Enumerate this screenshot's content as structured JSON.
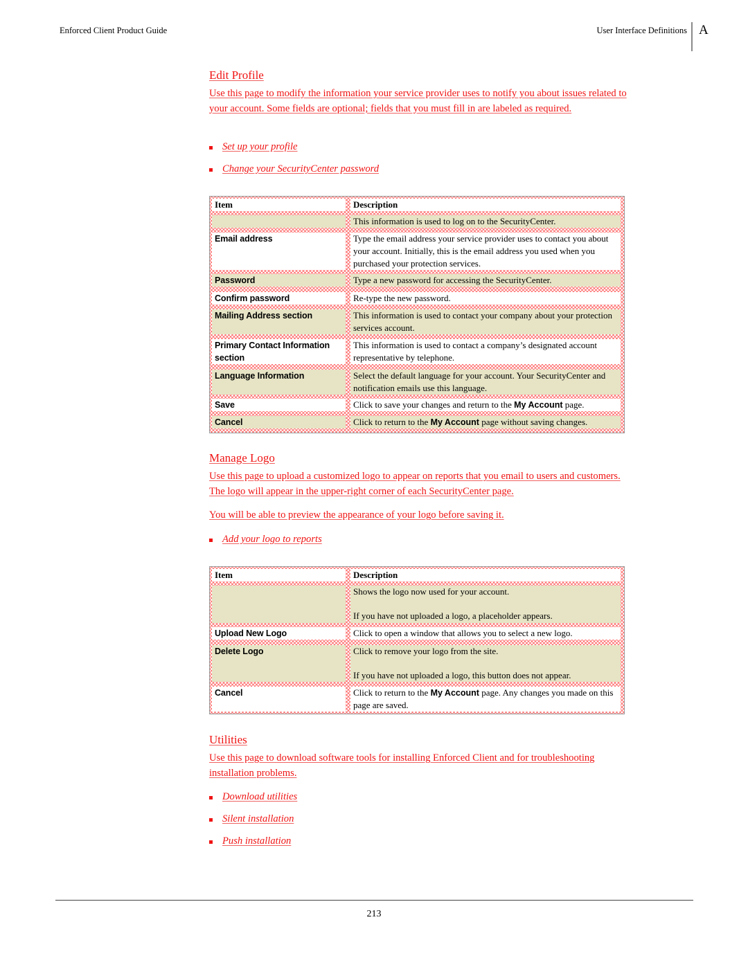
{
  "header": {
    "left": "Enforced Client Product Guide",
    "right": "User Interface Definitions",
    "appendix_letter": "A"
  },
  "colors": {
    "link_red": "#f01414",
    "hatch_red": "#ff3a3a",
    "shaded_row": "#e6e4c5"
  },
  "sections": [
    {
      "title": "Edit Profile",
      "paragraphs": [
        "Use this page to modify the information your service provider uses to notify you about issues related to your account. Some fields are optional; fields that you must fill in are labeled as required."
      ],
      "links": [
        "Set up your profile",
        "Change your SecurityCenter password"
      ],
      "table": {
        "headers": [
          "Item",
          "Description"
        ],
        "rows": [
          {
            "item": "",
            "desc": "This information is used to log on to the SecurityCenter."
          },
          {
            "item": "Email address",
            "desc": "Type the email address your service provider uses to contact you about your account. Initially, this is the email address you used when you purchased your protection services."
          },
          {
            "item": "Password",
            "desc": "Type a new password for accessing the SecurityCenter."
          },
          {
            "item": "Confirm password",
            "desc": "Re-type the new password."
          },
          {
            "item": "Mailing Address section",
            "desc": "This information is used to contact your company about your protection services account."
          },
          {
            "item": "Primary Contact Information section",
            "desc": "This information is used to contact a company’s designated account representative by telephone."
          },
          {
            "item": "Language Information",
            "desc": "Select the default language for your account. Your SecurityCenter and notification emails use this language."
          },
          {
            "item": "Save",
            "desc_pre": "Click to save your changes and return to the ",
            "desc_ui": "My Account",
            "desc_post": " page."
          },
          {
            "item": "Cancel",
            "desc_pre": "Click to return to the ",
            "desc_ui": "My Account",
            "desc_post": " page without saving changes."
          }
        ]
      }
    },
    {
      "title": "Manage Logo",
      "paragraphs": [
        "Use this page to upload a customized logo to appear on reports that you email to users and customers. The logo will appear in the upper-right corner of each SecurityCenter page.",
        "You will be able to preview the appearance of your logo before saving it."
      ],
      "links": [
        "Add your logo to reports"
      ],
      "table": {
        "headers": [
          "Item",
          "Description"
        ],
        "rows": [
          {
            "item": "",
            "desc": "Shows the logo now used for your account.",
            "desc2": "If you have not uploaded a logo, a placeholder appears."
          },
          {
            "item": "Upload New Logo",
            "desc": "Click to open a window that allows you to select a new logo."
          },
          {
            "item": "Delete Logo",
            "desc": "Click to remove your logo from the site.",
            "desc2": "If you have not uploaded a logo, this button does not appear."
          },
          {
            "item": "Cancel",
            "desc_pre": "Click to return to the ",
            "desc_ui": "My Account",
            "desc_post": " page. Any changes you made on this page are saved."
          }
        ]
      }
    },
    {
      "title": "Utilities",
      "paragraphs": [
        "Use this page to download software tools for installing Enforced Client and for troubleshooting installation problems."
      ],
      "links": [
        "Download utilities",
        "Silent installation",
        "Push installation"
      ]
    }
  ],
  "footer": {
    "page_number": "213"
  }
}
